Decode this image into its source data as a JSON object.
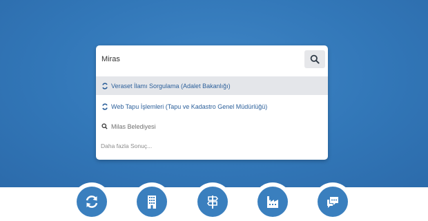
{
  "search": {
    "query": "Miras",
    "button_icon": "search-icon"
  },
  "suggestions": [
    {
      "label": "Veraset İlamı Sorgulama (Adalet Bakanlığı)",
      "icon": "edevlet-icon",
      "highlighted": true
    },
    {
      "label": "Web Tapu İşlemleri (Tapu ve Kadastro Genel Müdürlüğü)",
      "icon": "edevlet-icon",
      "highlighted": false
    },
    {
      "label": "Milas Belediyesi",
      "icon": "search-icon",
      "highlighted": false
    }
  ],
  "more_results": "Daha fazla Sonuç...",
  "services": [
    {
      "icon": "refresh-icon"
    },
    {
      "icon": "building-icon"
    },
    {
      "icon": "signpost-icon"
    },
    {
      "icon": "factory-icon"
    },
    {
      "icon": "chat-icon"
    }
  ],
  "colors": {
    "hero": "#3277b8",
    "link": "#2b5f9a",
    "icon_circle": "#3a7fbe"
  }
}
